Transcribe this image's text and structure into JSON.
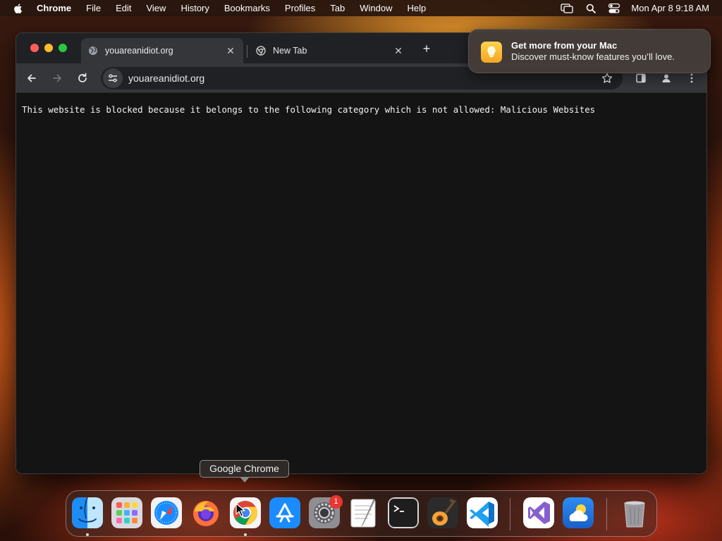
{
  "menubar": {
    "app_name": "Chrome",
    "items": [
      "File",
      "Edit",
      "View",
      "History",
      "Bookmarks",
      "Profiles",
      "Tab",
      "Window",
      "Help"
    ],
    "clock": "Mon Apr 8  9:18 AM",
    "status_icons": [
      "screen-mirroring-icon",
      "spotlight-icon",
      "control-center-icon"
    ]
  },
  "browser": {
    "tabs": [
      {
        "title": "youareanidiot.org",
        "active": true,
        "favicon": "globe-icon"
      },
      {
        "title": "New Tab",
        "active": false,
        "favicon": "chrome-icon"
      }
    ],
    "address": "youareanidiot.org",
    "page_message": "This website is blocked because it belongs to the following category which is not allowed: Malicious Websites"
  },
  "notification": {
    "title": "Get more from your Mac",
    "body": "Discover must-know features you’ll love.",
    "icon": "lightbulb-icon"
  },
  "tooltip": "Google Chrome",
  "dock": {
    "apps": [
      "Finder",
      "Launchpad",
      "Safari",
      "Firefox",
      "Google Chrome",
      "App Store",
      "System Settings",
      "TextEdit",
      "Terminal",
      "GarageBand",
      "Visual Studio Code",
      "Visual Studio",
      "Weather",
      "Trash"
    ],
    "settings_badge": "1"
  }
}
